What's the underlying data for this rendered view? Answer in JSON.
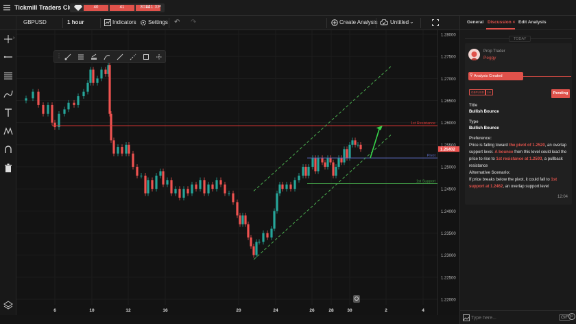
{
  "app": {
    "brand": "Tickmill Traders Club",
    "xp_segments": [
      "40",
      "41",
      "42"
    ],
    "xp_total": "30141 XP"
  },
  "toolbar": {
    "symbol": "GBPUSD",
    "interval": "1 hour",
    "indicators": "Indicators",
    "settings": "Settings",
    "create_analysis": "Create Analysis",
    "untitled": "Untitled"
  },
  "chart": {
    "price_ticks": [
      "1.28000",
      "1.27500",
      "1.27000",
      "1.26500",
      "1.26000",
      "1.25500",
      "1.25000",
      "1.24500",
      "1.24000",
      "1.23500",
      "1.23000",
      "1.22500",
      "1.22000"
    ],
    "time_ticks": [
      "6",
      "10",
      "12",
      "16",
      "20",
      "24",
      "26",
      "28",
      "30",
      "2",
      "4"
    ],
    "current_price": "1.25402",
    "levels": {
      "resistance": "1st Resistance",
      "pivot": "Pivot",
      "support": "1st Support"
    }
  },
  "panel": {
    "tabs": [
      "General",
      "Discussion",
      "Edit Analysis"
    ],
    "today": "Today",
    "role": "Prop Trader",
    "user": "Peggy",
    "event": "Analysis Created",
    "tag1": "GBPUSD",
    "tag2": "1H",
    "status": "Pending",
    "title_label": "Title",
    "title_value": "Bullish Bounce",
    "type_label": "Type",
    "type_value": "Bullish Bounce",
    "pref_label": "Preference:",
    "pref_1": "Price is falling toward ",
    "pref_hl1": "the pivot of 1.2520",
    "pref_2": ", an overlap support level. ",
    "pref_hl2": "A bounce",
    "pref_3": " from this level could lead the price to rise to ",
    "pref_hl3": "1st resistance at 1.2593",
    "pref_4": ", a pullback resistance",
    "alt_label": "Alternative Scenario:",
    "alt_1": "If price breaks below the pivot, it could fall to ",
    "alt_hl": "1st support at 1.2462",
    "alt_2": ", an overlap support level",
    "time": "12:04",
    "reply_placeholder": "Type here...",
    "gif": "GIF"
  },
  "colors": {
    "up": "#26a69a",
    "down": "#ef5350",
    "accent": "#e0524b",
    "resistance": "#e53935",
    "pivot": "#5c6bc0",
    "support": "#43a047",
    "channel": "#4caf50"
  }
}
